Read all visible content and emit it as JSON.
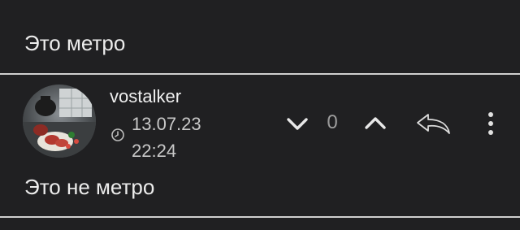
{
  "previous_comment": {
    "text": "Это метро"
  },
  "comment": {
    "username": "vostalker",
    "date": "13.07.23",
    "time": "22:24",
    "score": "0",
    "text": "Это не метро"
  },
  "icons": {
    "clock": "clock-icon",
    "downvote": "chevron-down-icon",
    "upvote": "chevron-up-icon",
    "reply": "reply-arrow-icon",
    "more": "more-vertical-icon"
  },
  "colors": {
    "background": "#202022",
    "divider": "#cfcfcf",
    "text": "#ececec",
    "muted": "#9e9e9e"
  }
}
